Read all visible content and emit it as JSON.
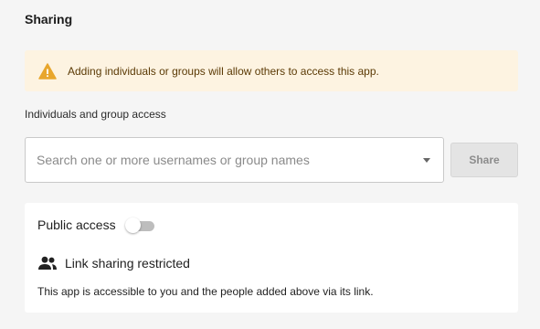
{
  "sharing": {
    "title": "Sharing",
    "warning": {
      "icon": "warning-icon",
      "text": "Adding individuals or groups will allow others to access this app.",
      "background": "#fdf3e1",
      "icon_color": "#e8a62c"
    },
    "access_label": "Individuals and group access",
    "search": {
      "placeholder": "Search one or more usernames or group names",
      "value": ""
    },
    "share_button": {
      "label": "Share",
      "enabled": false
    },
    "public_access": {
      "label": "Public access",
      "enabled": false
    },
    "link_sharing": {
      "icon": "people-icon",
      "label": "Link sharing restricted",
      "description": "This app is accessible to you and the people added above via its link."
    }
  }
}
